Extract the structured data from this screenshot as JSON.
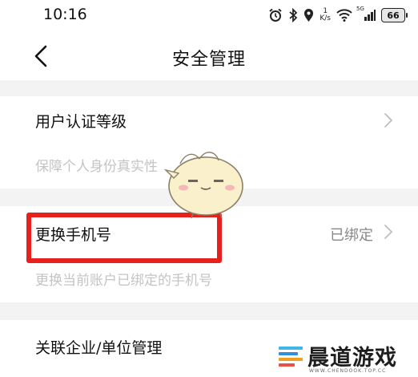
{
  "status_bar": {
    "time": "10:16",
    "net_speed_value": "1",
    "net_speed_unit": "K/s",
    "network_label": "5G",
    "battery": "66"
  },
  "header": {
    "title": "安全管理"
  },
  "items": [
    {
      "title": "用户认证等级",
      "desc": "保障个人身份真实性",
      "value": ""
    },
    {
      "title": "更换手机号",
      "desc": "更换当前账户已绑定的手机号",
      "value": "已绑定"
    },
    {
      "title": "关联企业/单位管理",
      "desc": "",
      "value": ""
    }
  ],
  "watermark": {
    "brand": "晨道游戏",
    "url": "WWW.CHENDOOK.TOP.CC"
  },
  "colors": {
    "highlight": "#e8201c",
    "section_gap": "#f3f3f3",
    "desc_text": "#c4c4c4"
  },
  "icons": [
    "alarm-icon",
    "bluetooth-icon",
    "location-icon",
    "wifi-icon",
    "signal-icon",
    "battery-icon",
    "back-arrow-icon",
    "chevron-right-icon"
  ]
}
